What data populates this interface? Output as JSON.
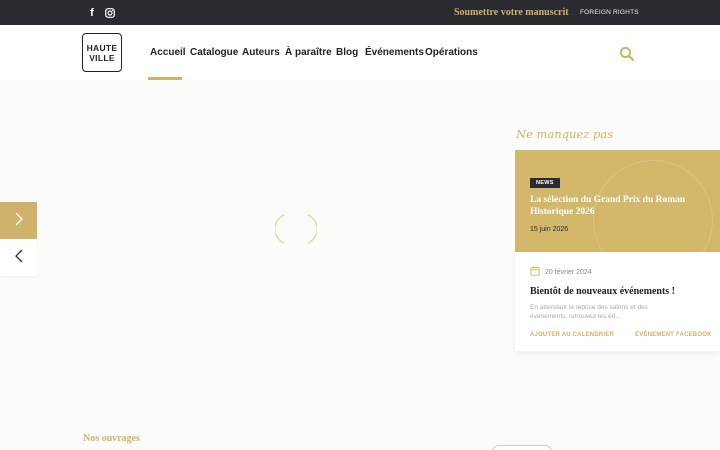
{
  "topbar": {
    "facebook_glyph": "f",
    "submit_label": "Soumettre votre manuscrit",
    "foreign_label": "FOREIGN RIGHTS"
  },
  "header": {
    "logo_line1": "HAUTE",
    "logo_line2": "VILLE",
    "nav": [
      "Accueil",
      "Catalogue",
      "Auteurs",
      "À paraître",
      "Blog",
      "Événements",
      "Opérations"
    ],
    "active_index": 0
  },
  "sidebar": {
    "heading": "Ne manquez pas"
  },
  "news": {
    "badge": "NEWS",
    "title": "La sélection du Grand Prix du Roman Historique 2026",
    "date": "15 juin 2026"
  },
  "event": {
    "date": "20 février 2024",
    "title": "Bientôt de nouveaux événements !",
    "description": "En attendant la reprise des salons et des événements, retrouvez les éd...",
    "link_calendar": "AJOUTER AU CALENDRIER",
    "link_facebook": "ÉVÉNEMENT FACEBOOK"
  },
  "section": {
    "title": "Nos ouvrages"
  },
  "colors": {
    "accent": "#cfb36a",
    "dark": "#2a2b30"
  },
  "icons": {
    "facebook": "facebook-icon",
    "instagram": "instagram-icon",
    "search": "search-icon",
    "next": "chevron-right-icon",
    "prev": "chevron-left-icon",
    "calendar": "calendar-icon"
  }
}
